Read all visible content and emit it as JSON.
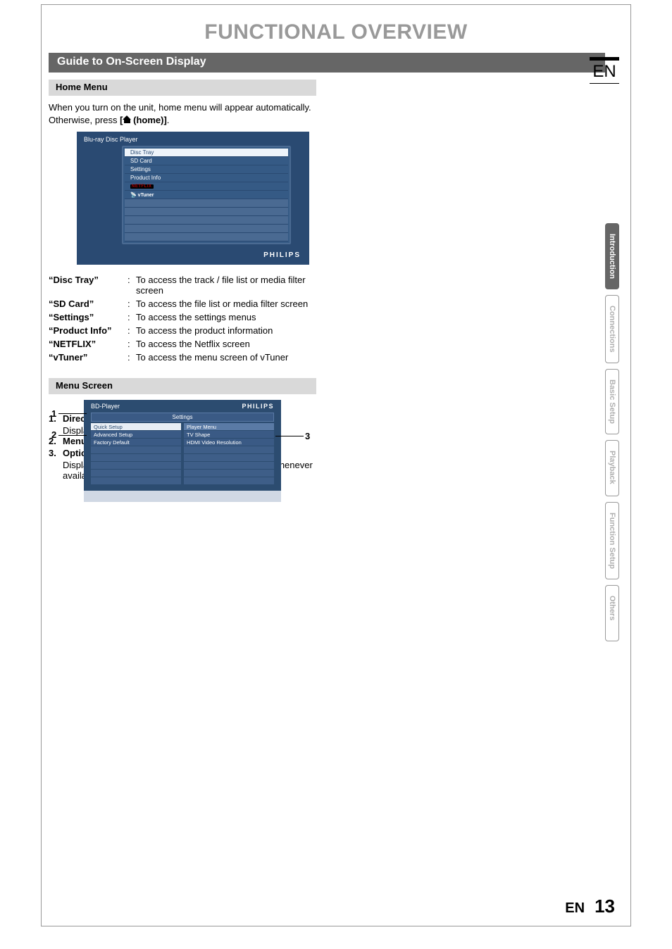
{
  "page": {
    "title": "FUNCTIONAL OVERVIEW",
    "lang_badge": "EN",
    "footer_lang": "EN",
    "footer_page": "13"
  },
  "section": {
    "guide_title": "Guide to On-Screen Display",
    "home_menu": "Home Menu",
    "menu_screen": "Menu Screen"
  },
  "intro_text_1": "When you turn on the unit, home menu will appear automatically. Otherwise, press ",
  "intro_text_2": "[",
  "intro_text_3": " (home)]",
  "intro_text_4": ".",
  "home_tv": {
    "header": "Blu-ray Disc Player",
    "brand": "PHILIPS",
    "rows": [
      "Disc Tray",
      "SD Card",
      "Settings",
      "Product Info",
      "NETFLIX",
      "vTuner"
    ]
  },
  "defs": [
    {
      "term": "“Disc Tray”",
      "desc": "To access the track / file list or media filter screen"
    },
    {
      "term": "“SD Card”",
      "desc": "To access the file list or media filter screen"
    },
    {
      "term": "“Settings”",
      "desc": "To access the settings menus"
    },
    {
      "term": "“Product Info”",
      "desc": "To access the product information"
    },
    {
      "term": "“NETFLIX”",
      "desc": "To access the Netflix screen"
    },
    {
      "term": "“vTuner”",
      "desc": "To access the menu screen of vTuner"
    }
  ],
  "menu_tv": {
    "header": "BD-Player",
    "brand": "PHILIPS",
    "crumb": "Settings",
    "left": [
      "Quick Setup",
      "Advanced Setup",
      "Factory Default"
    ],
    "right": [
      "Player Menu",
      "TV Shape",
      "HDMI Video Resolution"
    ]
  },
  "callout_labels": {
    "c1": "1",
    "c2": "2",
    "c3": "3"
  },
  "numbered": [
    {
      "n": "1.",
      "head": "Directory",
      "body": "Displays the current hierarchy."
    },
    {
      "n": "2.",
      "head": "Menus",
      "body": ""
    },
    {
      "n": "3.",
      "head": "Options",
      "body": "Displays options for the high-lighted item on the left whenever available."
    }
  ],
  "side_tabs": [
    "Introduction",
    "Connections",
    "Basic Setup",
    "Playback",
    "Function Setup",
    "Others"
  ]
}
